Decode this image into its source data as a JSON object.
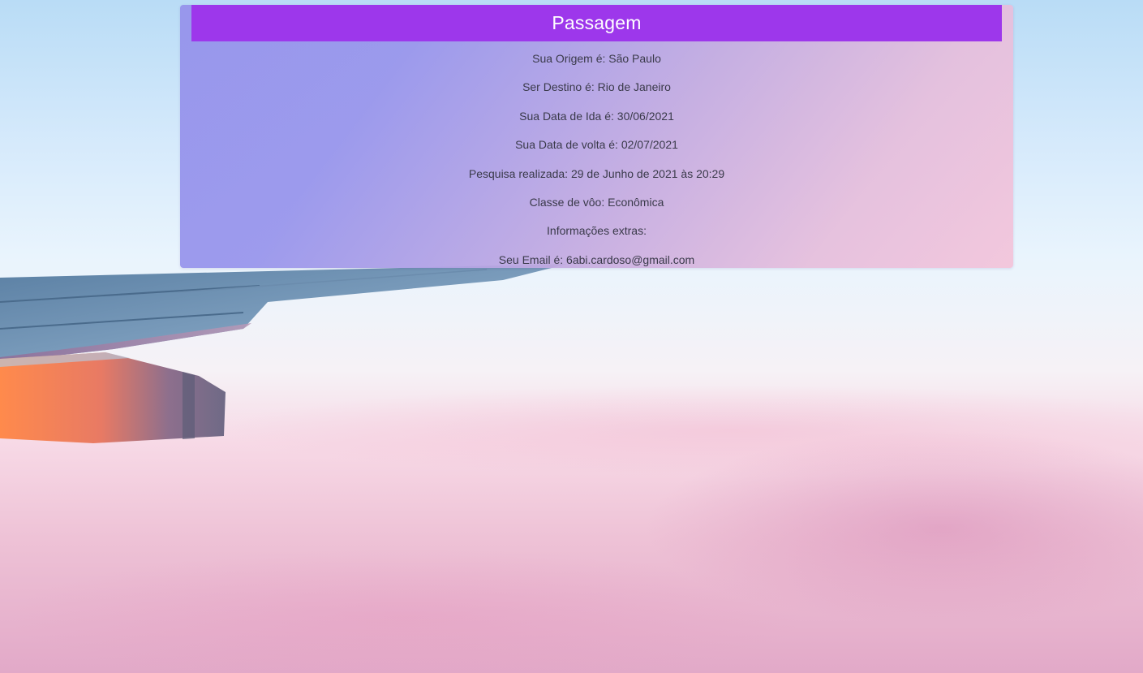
{
  "ticket": {
    "title": "Passagem",
    "lines": [
      "Sua Origem é: São Paulo",
      "Ser Destino é: Rio de Janeiro",
      "Sua Data de Ida é: 30/06/2021",
      "Sua Data de volta é: 02/07/2021",
      "Pesquisa realizada: 29 de Junho de 2021 às 20:29",
      "Classe de vôo: Econômica",
      "Informações extras:",
      "Seu Email é: 6abi.cardoso@gmail.com"
    ]
  },
  "colors": {
    "header_bg": "#9d37eb",
    "header_text": "#ffffff",
    "body_text": "#3a3a4a"
  }
}
